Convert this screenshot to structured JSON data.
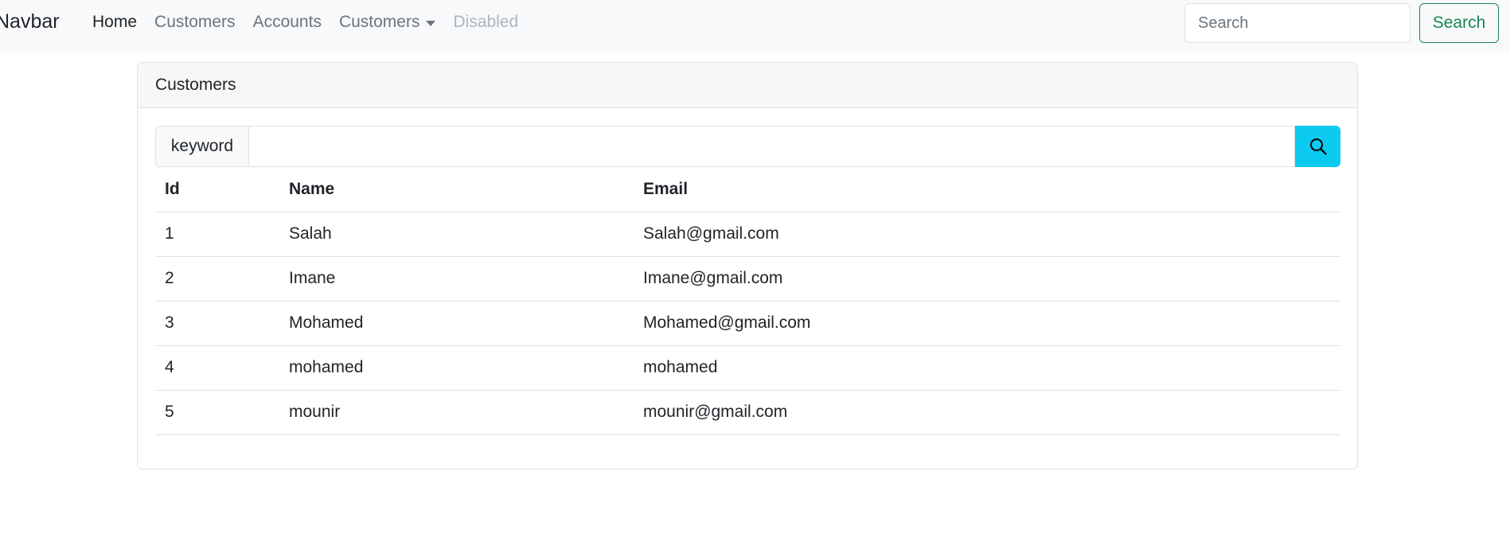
{
  "navbar": {
    "brand": "Navbar",
    "links": [
      {
        "label": "Home",
        "state": "active"
      },
      {
        "label": "Customers",
        "state": "normal"
      },
      {
        "label": "Accounts",
        "state": "normal"
      },
      {
        "label": "Customers",
        "state": "dropdown"
      },
      {
        "label": "Disabled",
        "state": "disabled"
      }
    ],
    "search_placeholder": "Search",
    "search_button": "Search",
    "colors": {
      "search_button": "#198754"
    }
  },
  "card": {
    "title": "Customers",
    "keyword_label": "keyword",
    "keyword_value": "",
    "search_icon": "search-icon",
    "search_button_color": "#0dcaf0"
  },
  "table": {
    "headers": [
      "Id",
      "Name",
      "Email"
    ],
    "rows": [
      [
        "1",
        "Salah",
        "Salah@gmail.com"
      ],
      [
        "2",
        "Imane",
        "Imane@gmail.com"
      ],
      [
        "3",
        "Mohamed",
        "Mohamed@gmail.com"
      ],
      [
        "4",
        "mohamed",
        "mohamed"
      ],
      [
        "5",
        "mounir",
        "mounir@gmail.com"
      ]
    ]
  }
}
